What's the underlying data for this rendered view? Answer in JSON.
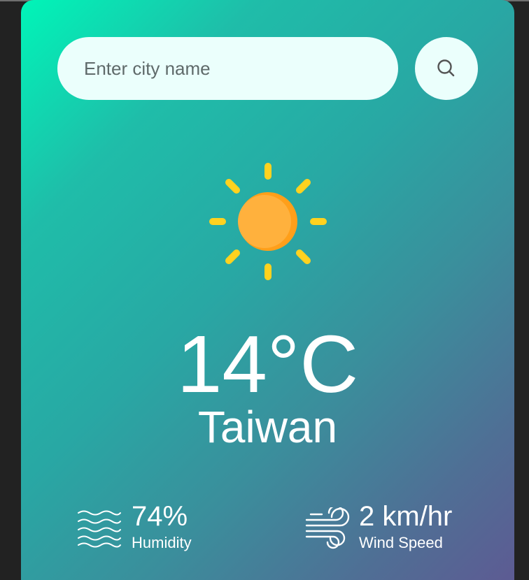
{
  "search": {
    "placeholder": "Enter city name",
    "button_icon": "search-icon"
  },
  "weather": {
    "icon": "sun-icon",
    "temperature": "14°C",
    "city": "Taiwan"
  },
  "stats": {
    "humidity": {
      "icon": "humidity-waves-icon",
      "value": "74%",
      "label": "Humidity"
    },
    "wind": {
      "icon": "wind-icon",
      "value": "2 km/hr",
      "label": "Wind Speed"
    }
  },
  "colors": {
    "gradient_start": "#00f5b8",
    "gradient_end": "#5d5b93",
    "input_bg": "#ebfffc",
    "sun_body": "#ffb13d",
    "sun_rays": "#ffd21f",
    "text": "#ffffff"
  }
}
